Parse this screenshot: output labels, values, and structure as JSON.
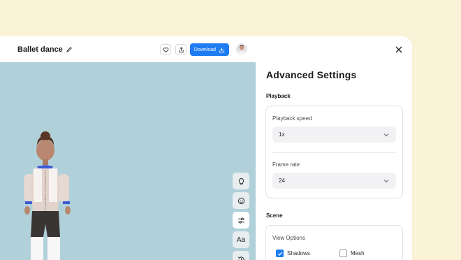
{
  "header": {
    "title": "Ballet dance",
    "download_label": "Download"
  },
  "viewport_tools": [
    "lightbulb-icon",
    "face-icon",
    "sliders-icon",
    "Aa",
    "history-icon"
  ],
  "panel": {
    "title": "Advanced Settings",
    "playback": {
      "section_label": "Playback",
      "speed_label": "Playback speed",
      "speed_value": "1x",
      "frame_rate_label": "Frame rate",
      "frame_rate_value": "24"
    },
    "scene": {
      "section_label": "Scene",
      "view_options_label": "View Options",
      "shadows_label": "Shadows",
      "shadows_checked": true,
      "mesh_label": "Mesh",
      "mesh_checked": false
    }
  },
  "colors": {
    "accent": "#1e7cf2",
    "background": "#faf3d8",
    "viewport": "#b1d1da"
  }
}
